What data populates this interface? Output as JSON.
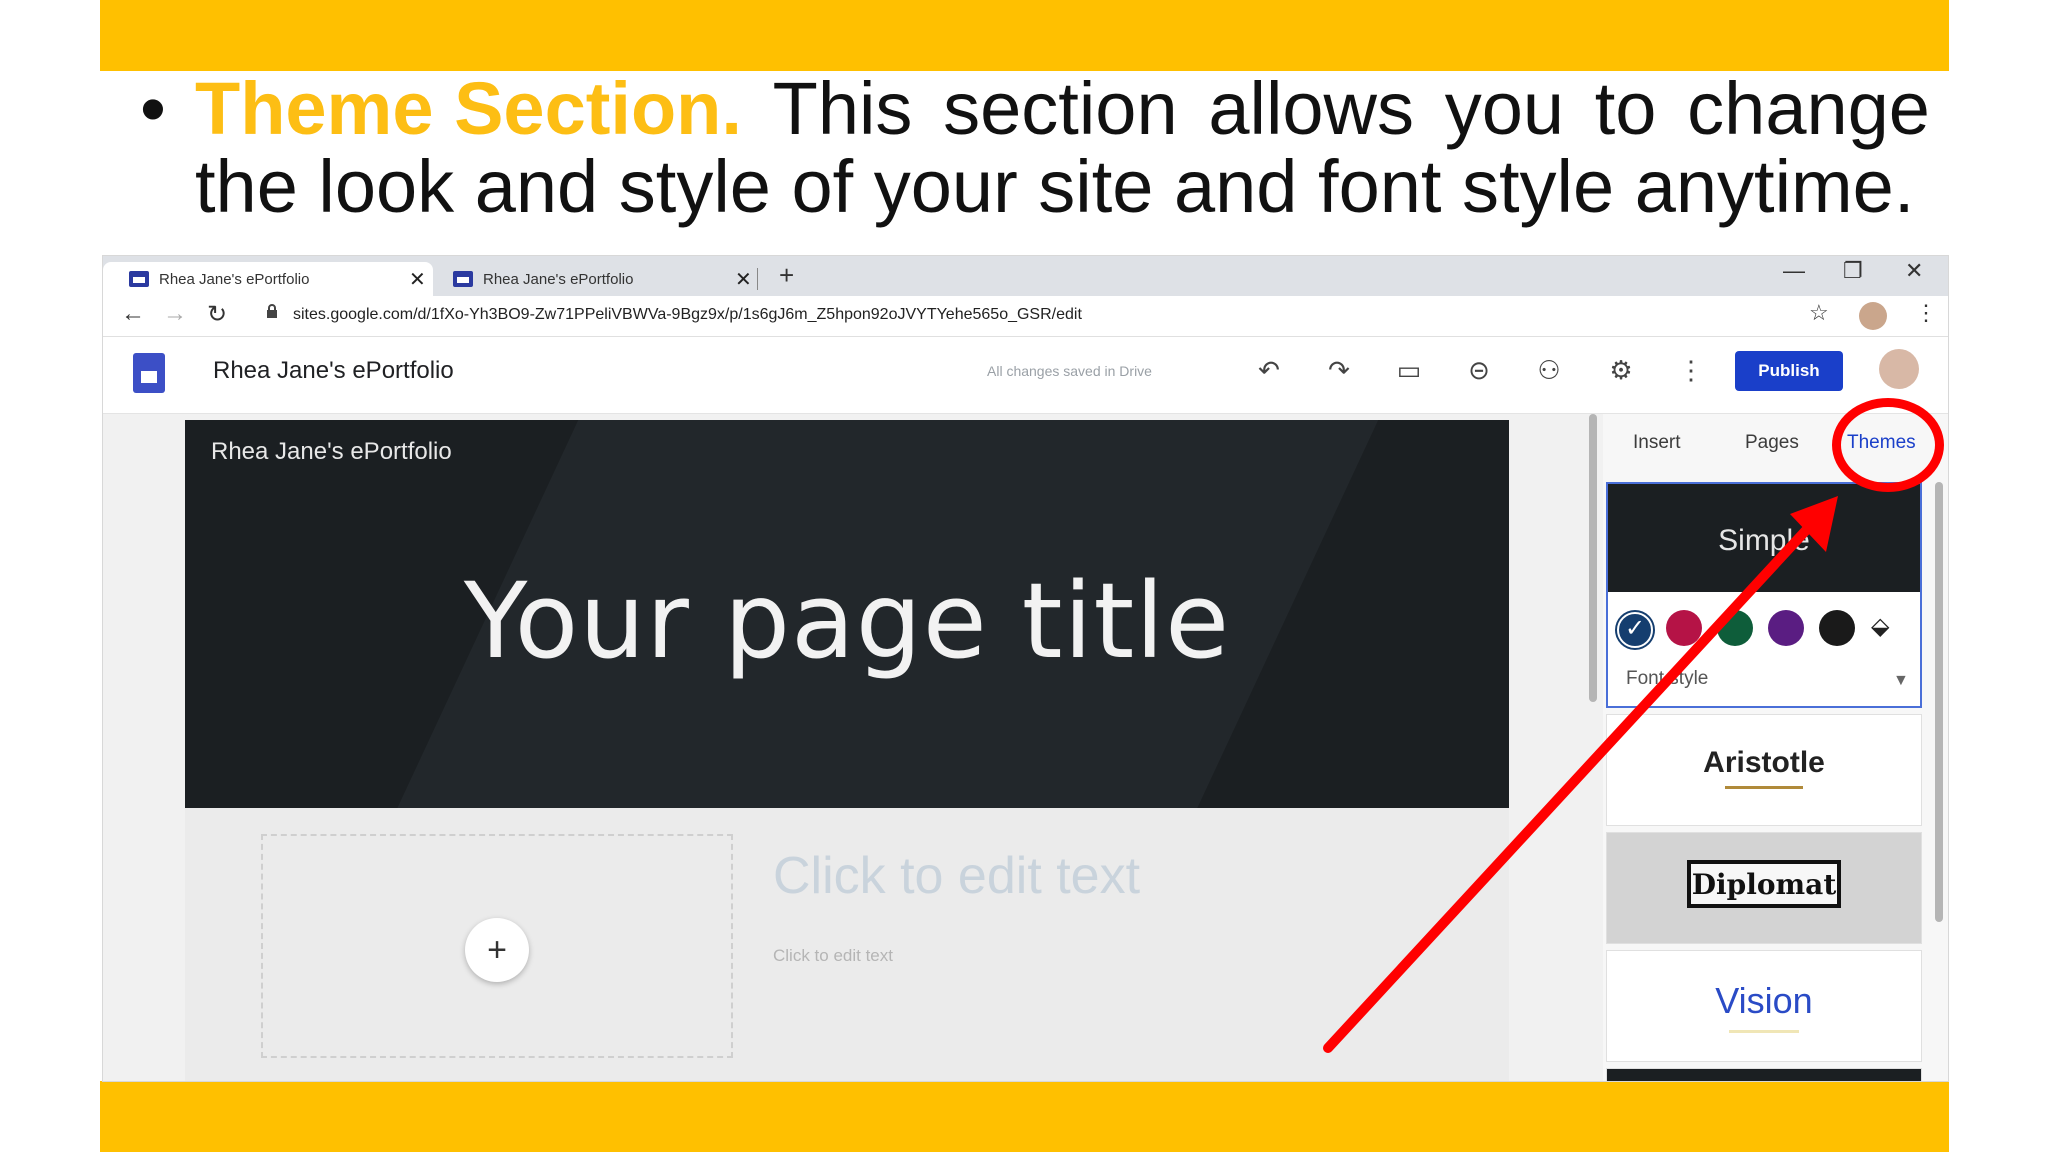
{
  "slide": {
    "highlight": "Theme Section.",
    "line1_words": [
      "This",
      "section",
      "allows",
      "you",
      "to",
      "change"
    ],
    "line2": "the look and style of your site and font style anytime.",
    "bullet": "•",
    "colors": {
      "band": "#FFC000",
      "highlight": "#FDBE14",
      "annotation": "#FF0000"
    }
  },
  "browser": {
    "tabs": [
      {
        "label": "Rhea Jane's ePortfolio",
        "close": "✕"
      },
      {
        "label": "Rhea Jane's ePortfolio",
        "close": "✕"
      }
    ],
    "new_tab": "+",
    "window_controls": {
      "minimize": "—",
      "restore": "❐",
      "close": "✕"
    },
    "nav": {
      "back": "←",
      "forward": "→",
      "reload": "↻"
    },
    "url": "sites.google.com/d/1fXo-Yh3BO9-Zw71PPeliVBWVa-9Bgz9x/p/1s6gJ6m_Z5hpon92oJVYTYehe565o_GSR/edit",
    "bookmark": "☆",
    "menu": "⋮"
  },
  "sites": {
    "doc_title": "Rhea Jane's ePortfolio",
    "save_status": "All changes saved in Drive",
    "toolbar": {
      "undo": "↶",
      "redo": "↷",
      "preview": "▭",
      "link": "⊝",
      "share": "⚇",
      "settings": "⚙",
      "more": "⋮"
    },
    "publish_label": "Publish"
  },
  "canvas": {
    "site_name": "Rhea Jane's ePortfolio",
    "page_title": "Your page title",
    "add": "+",
    "edit_big": "Click to edit text",
    "edit_small": "Click to edit text"
  },
  "panel": {
    "tabs": [
      "Insert",
      "Pages",
      "Themes"
    ],
    "active_tab": "Themes",
    "selected_theme": "Simple",
    "swatches": [
      "#153e6f",
      "#b51346",
      "#0e5d3a",
      "#5a1d82",
      "#1a1a1a"
    ],
    "check": "✓",
    "paint": "⬙",
    "font_style": "Font style",
    "caret": "▼",
    "themes": [
      "Aristotle",
      "Diplomat",
      "Vision"
    ]
  }
}
